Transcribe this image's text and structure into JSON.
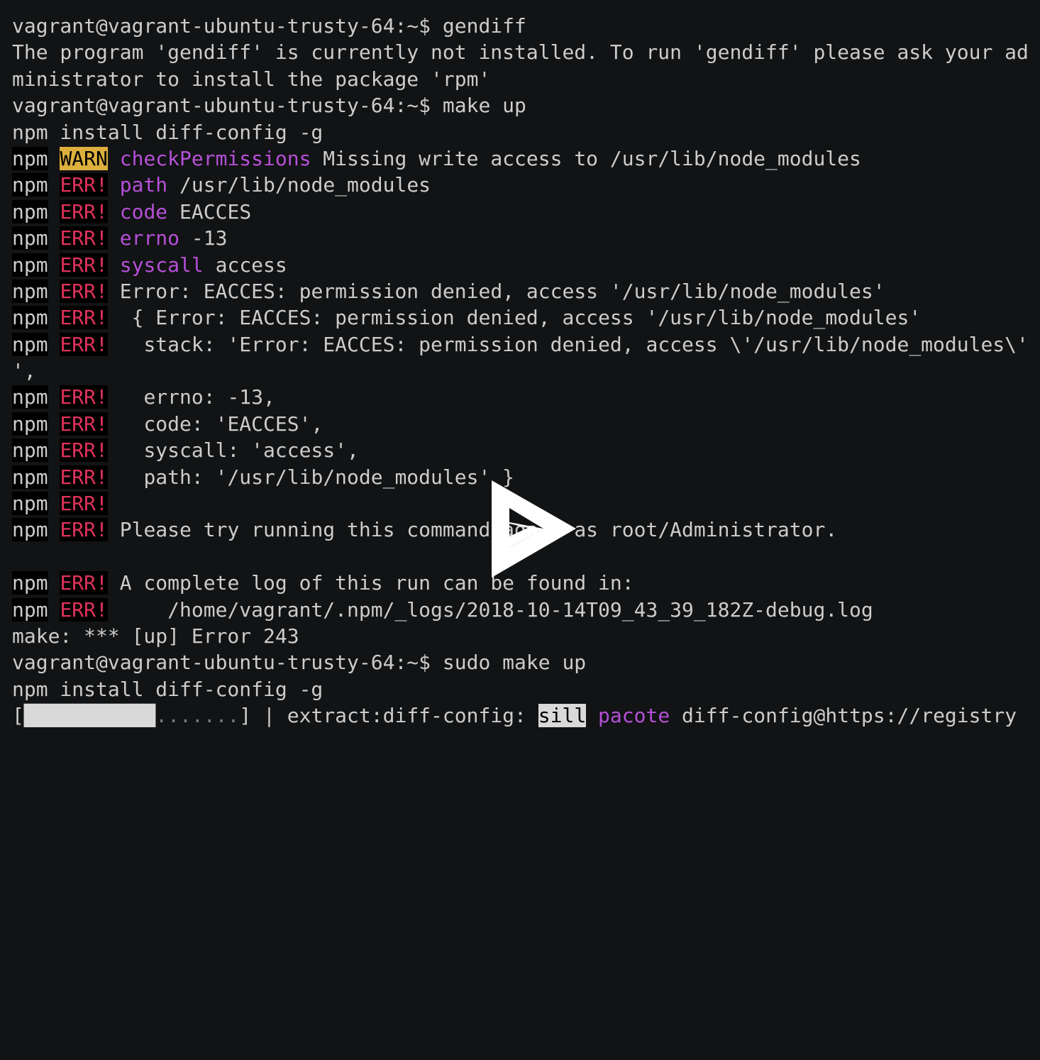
{
  "terminal": {
    "colors": {
      "background": "#121314",
      "foreground": "#cccccc",
      "error": "#e0325a",
      "warn_bg": "#ddb03e",
      "keyword": "#b550d8"
    },
    "lines": [
      [
        {
          "t": "vagrant@vagrant-ubuntu-trusty-64:~$ gendiff"
        }
      ],
      [
        {
          "t": "The program 'gendiff' is currently not installed. To run 'gendiff' please ask your ad"
        }
      ],
      [
        {
          "t": "ministrator to install the package 'rpm'"
        }
      ],
      [
        {
          "t": "vagrant@vagrant-ubuntu-trusty-64:~$ make up"
        }
      ],
      [
        {
          "t": "npm install diff-config -g"
        }
      ],
      [
        {
          "t": "npm",
          "c": "k"
        },
        {
          "t": " "
        },
        {
          "t": "WARN",
          "c": "warn"
        },
        {
          "t": " "
        },
        {
          "t": "checkPermissions",
          "c": "mag"
        },
        {
          "t": " Missing write access to /usr/lib/node_modules"
        }
      ],
      [
        {
          "t": "npm",
          "c": "k"
        },
        {
          "t": " "
        },
        {
          "t": "ERR!",
          "c": "err"
        },
        {
          "t": " "
        },
        {
          "t": "path",
          "c": "mag"
        },
        {
          "t": " /usr/lib/node_modules"
        }
      ],
      [
        {
          "t": "npm",
          "c": "k"
        },
        {
          "t": " "
        },
        {
          "t": "ERR!",
          "c": "err"
        },
        {
          "t": " "
        },
        {
          "t": "code",
          "c": "mag"
        },
        {
          "t": " EACCES"
        }
      ],
      [
        {
          "t": "npm",
          "c": "k"
        },
        {
          "t": " "
        },
        {
          "t": "ERR!",
          "c": "err"
        },
        {
          "t": " "
        },
        {
          "t": "errno",
          "c": "mag"
        },
        {
          "t": " -13"
        }
      ],
      [
        {
          "t": "npm",
          "c": "k"
        },
        {
          "t": " "
        },
        {
          "t": "ERR!",
          "c": "err"
        },
        {
          "t": " "
        },
        {
          "t": "syscall",
          "c": "mag"
        },
        {
          "t": " access"
        }
      ],
      [
        {
          "t": "npm",
          "c": "k"
        },
        {
          "t": " "
        },
        {
          "t": "ERR!",
          "c": "err"
        },
        {
          "t": " Error: EACCES: permission denied, access '/usr/lib/node_modules'"
        }
      ],
      [
        {
          "t": "npm",
          "c": "k"
        },
        {
          "t": " "
        },
        {
          "t": "ERR!",
          "c": "err"
        },
        {
          "t": "  { Error: EACCES: permission denied, access '/usr/lib/node_modules'"
        }
      ],
      [
        {
          "t": "npm",
          "c": "k"
        },
        {
          "t": " "
        },
        {
          "t": "ERR!",
          "c": "err"
        },
        {
          "t": "   stack: 'Error: EACCES: permission denied, access \\'/usr/lib/node_modules\\'"
        }
      ],
      [
        {
          "t": "',"
        }
      ],
      [
        {
          "t": "npm",
          "c": "k"
        },
        {
          "t": " "
        },
        {
          "t": "ERR!",
          "c": "err"
        },
        {
          "t": "   errno: -13,"
        }
      ],
      [
        {
          "t": "npm",
          "c": "k"
        },
        {
          "t": " "
        },
        {
          "t": "ERR!",
          "c": "err"
        },
        {
          "t": "   code: 'EACCES',"
        }
      ],
      [
        {
          "t": "npm",
          "c": "k"
        },
        {
          "t": " "
        },
        {
          "t": "ERR!",
          "c": "err"
        },
        {
          "t": "   syscall: 'access',"
        }
      ],
      [
        {
          "t": "npm",
          "c": "k"
        },
        {
          "t": " "
        },
        {
          "t": "ERR!",
          "c": "err"
        },
        {
          "t": "   path: '/usr/lib/node_modules' }"
        }
      ],
      [
        {
          "t": "npm",
          "c": "k"
        },
        {
          "t": " "
        },
        {
          "t": "ERR!",
          "c": "err"
        }
      ],
      [
        {
          "t": "npm",
          "c": "k"
        },
        {
          "t": " "
        },
        {
          "t": "ERR!",
          "c": "err"
        },
        {
          "t": " Please try running this command again as root/Administrator."
        }
      ],
      [],
      [
        {
          "t": "npm",
          "c": "k"
        },
        {
          "t": " "
        },
        {
          "t": "ERR!",
          "c": "err"
        },
        {
          "t": " A complete log of this run can be found in:"
        }
      ],
      [
        {
          "t": "npm",
          "c": "k"
        },
        {
          "t": " "
        },
        {
          "t": "ERR!",
          "c": "err"
        },
        {
          "t": "     /home/vagrant/.npm/_logs/2018-10-14T09_43_39_182Z-debug.log"
        }
      ],
      [
        {
          "t": "make: *** [up] Error 243"
        }
      ],
      [
        {
          "t": "vagrant@vagrant-ubuntu-trusty-64:~$ sudo make up"
        }
      ],
      [
        {
          "t": "npm install diff-config -g"
        }
      ],
      [
        {
          "t": "["
        },
        {
          "t": "███████████",
          "c": "bar"
        },
        {
          "t": ".......",
          "c": "dim"
        },
        {
          "t": "] | extract:diff-config: "
        },
        {
          "t": "sill",
          "c": "inv"
        },
        {
          "t": " "
        },
        {
          "t": "pacote",
          "c": "mag"
        },
        {
          "t": " diff-config@https://registry"
        }
      ]
    ],
    "progress": {
      "filled_cells": 11,
      "total_cells": 18
    }
  },
  "player": {
    "play_icon": "asciinema-play-icon"
  }
}
